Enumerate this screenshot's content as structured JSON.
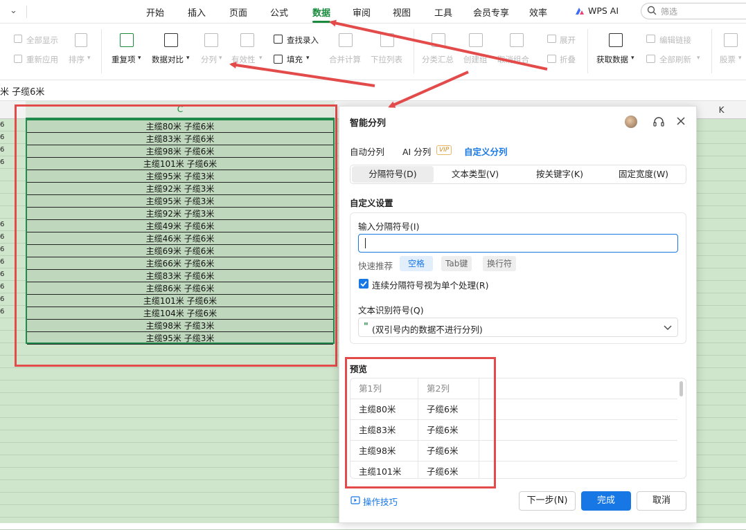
{
  "menu": {
    "items": [
      "开始",
      "插入",
      "页面",
      "公式",
      "数据",
      "审阅",
      "视图",
      "工具",
      "会员专享",
      "效率"
    ],
    "active": "数据",
    "wps_ai": "WPS AI",
    "search_placeholder": "筛选"
  },
  "ribbon": {
    "show_all": "全部显示",
    "reapply": "重新应用",
    "sort": "排序",
    "duplicates": "重复项",
    "compare": "数据对比",
    "split": "分列",
    "validity": "有效性",
    "find_entry": "查找录入",
    "fill": "填充",
    "merge_calc": "合并计算",
    "dropdown": "下拉列表",
    "subtotal": "分类汇总",
    "create_group": "创建组",
    "ungroup": "取消组合",
    "expand": "展开",
    "collapse": "折叠",
    "get_data": "获取数据",
    "edit_links": "编辑链接",
    "refresh_all": "全部刷新",
    "stocks": "股票"
  },
  "formula_bar": {
    "content": "米 子缆6米"
  },
  "sheet": {
    "col_c": "C",
    "col_k": "K",
    "cells": [
      "主缆80米  子缆6米",
      "主缆83米  子缆6米",
      "主缆98米  子缆6米",
      "主缆101米  子缆6米",
      "主缆95米  子缆3米",
      "主缆92米  子缆3米",
      "主缆95米  子缆3米",
      "主缆92米  子缆3米",
      "主缆49米  子缆6米",
      "主缆46米  子缆6米",
      "主缆69米  子缆6米",
      "主缆66米  子缆6米",
      "主缆83米  子缆6米",
      "主缆86米  子缆6米",
      "主缆101米  子缆6米",
      "主缆104米  子缆6米",
      "主缆98米  子缆3米",
      "主缆95米  子缆3米"
    ],
    "left_marks": [
      "6",
      "6",
      "6",
      "6",
      "",
      "",
      "",
      "",
      "6",
      "6",
      "6",
      "6",
      "6",
      "6",
      "6",
      "6",
      "",
      ""
    ]
  },
  "dialog": {
    "title": "智能分列",
    "modes": [
      "自动分列",
      "AI 分列",
      "自定义分列"
    ],
    "vip_badge": "VIP",
    "active_mode": "自定义分列",
    "tabs": [
      "分隔符号(D)",
      "文本类型(V)",
      "按关键字(K)",
      "固定宽度(W)"
    ],
    "section_title": "自定义设置",
    "delimiter_label": "输入分隔符号(I)",
    "delimiter_value": "",
    "quick_label": "快速推荐",
    "chips": [
      "空格",
      "Tab键",
      "换行符"
    ],
    "consecutive_label": "连续分隔符号视为单个处理(R)",
    "text_qualifier_label": "文本识别符号(Q)",
    "text_qualifier_symbol": "\"",
    "text_qualifier_value": "(双引号内的数据不进行分列)",
    "preview_title": "预览",
    "preview_headers": [
      "第1列",
      "第2列"
    ],
    "preview_rows": [
      [
        "主缆80米",
        "子缆6米"
      ],
      [
        "主缆83米",
        "子缆6米"
      ],
      [
        "主缆98米",
        "子缆6米"
      ],
      [
        "主缆101米",
        "子缆6米"
      ]
    ],
    "tips": "操作技巧",
    "next": "下一步(N)",
    "finish": "完成",
    "cancel": "取消"
  },
  "colors": {
    "accent_green": "#1a8a3c",
    "primary_blue": "#1677e5",
    "annotation_red": "#e34b4b",
    "sheet_bg": "#cfe5cc"
  }
}
